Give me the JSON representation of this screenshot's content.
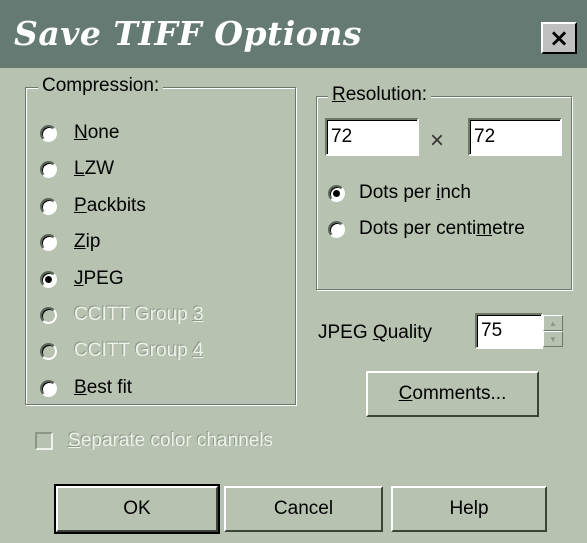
{
  "window": {
    "title": "Save TIFF Options",
    "close_glyph": "×"
  },
  "compression": {
    "label": "Compression:",
    "options": [
      {
        "pre": "",
        "key": "N",
        "post": "one",
        "checked": false,
        "disabled": false
      },
      {
        "pre": "",
        "key": "L",
        "post": "ZW",
        "checked": false,
        "disabled": false
      },
      {
        "pre": "",
        "key": "P",
        "post": "ackbits",
        "checked": false,
        "disabled": false
      },
      {
        "pre": "",
        "key": "Z",
        "post": "ip",
        "checked": false,
        "disabled": false
      },
      {
        "pre": "",
        "key": "J",
        "post": "PEG",
        "checked": true,
        "disabled": false
      },
      {
        "pre": "CCITT Group ",
        "key": "3",
        "post": "",
        "checked": false,
        "disabled": true
      },
      {
        "pre": "CCITT Group ",
        "key": "4",
        "post": "",
        "checked": false,
        "disabled": true
      },
      {
        "pre": "",
        "key": "B",
        "post": "est fit",
        "checked": false,
        "disabled": false
      }
    ]
  },
  "resolution": {
    "label_key": "R",
    "label_rest": "esolution:",
    "x_value": "72",
    "y_value": "72",
    "times_glyph": "×",
    "units": [
      {
        "pre": "Dots per ",
        "key": "i",
        "post": "nch",
        "checked": true
      },
      {
        "pre": "Dots per centi",
        "key": "m",
        "post": "etre",
        "checked": false
      }
    ]
  },
  "jpeg_quality": {
    "label_pre": "JPEG ",
    "label_key": "Q",
    "label_post": "uality",
    "value": "75",
    "up_glyph": "▲",
    "down_glyph": "▼"
  },
  "buttons": {
    "comments_key": "C",
    "comments_rest": "omments...",
    "ok": "OK",
    "cancel": "Cancel",
    "help": "Help"
  },
  "separate_channels": {
    "key": "S",
    "rest": "eparate color channels",
    "checked": false,
    "disabled": true
  }
}
